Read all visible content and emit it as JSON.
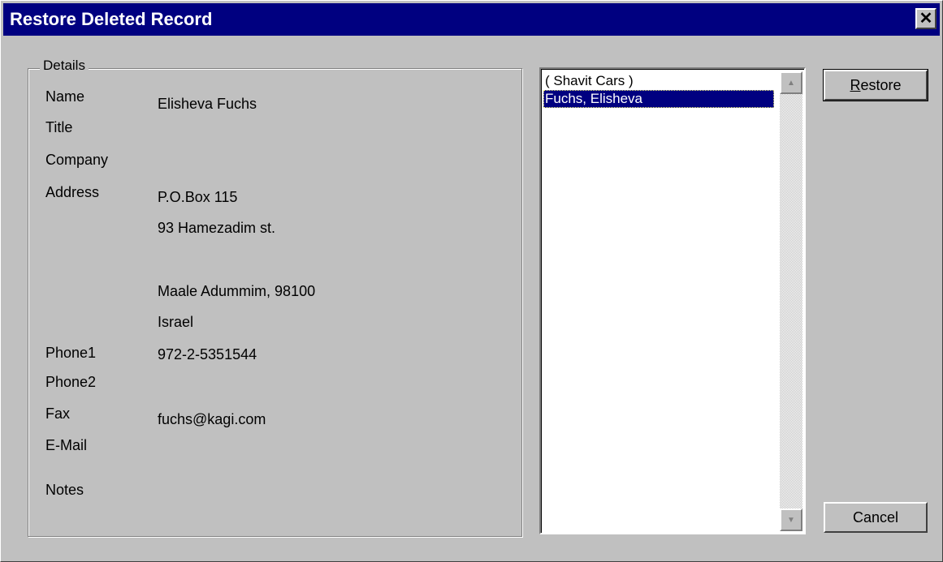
{
  "window": {
    "title": "Restore Deleted Record",
    "close_glyph": "✕"
  },
  "details": {
    "legend": "Details",
    "labels": {
      "name": "Name",
      "title": "Title",
      "company": "Company",
      "address": "Address",
      "phone1": "Phone1",
      "phone2": "Phone2",
      "fax": "Fax",
      "email": "E-Mail",
      "notes": "Notes"
    },
    "values": {
      "name": "Elisheva Fuchs",
      "address_line1": "P.O.Box 115",
      "address_line2": "93 Hamezadim st.",
      "address_city": "Maale Adummim, 98100",
      "address_country": "Israel",
      "phone1": "972-2-5351544",
      "email": "fuchs@kagi.com"
    }
  },
  "list": {
    "items": [
      {
        "label": "( Shavit Cars )",
        "selected": false
      },
      {
        "label": "Fuchs, Elisheva",
        "selected": true
      }
    ]
  },
  "buttons": {
    "restore_prefix": "R",
    "restore_rest": "estore",
    "cancel": "Cancel"
  },
  "icons": {
    "scroll_up": "up-arrow-icon",
    "scroll_down": "down-arrow-icon"
  },
  "colors": {
    "titlebar": "#000080",
    "face": "#c0c0c0",
    "selection": "#000080"
  }
}
